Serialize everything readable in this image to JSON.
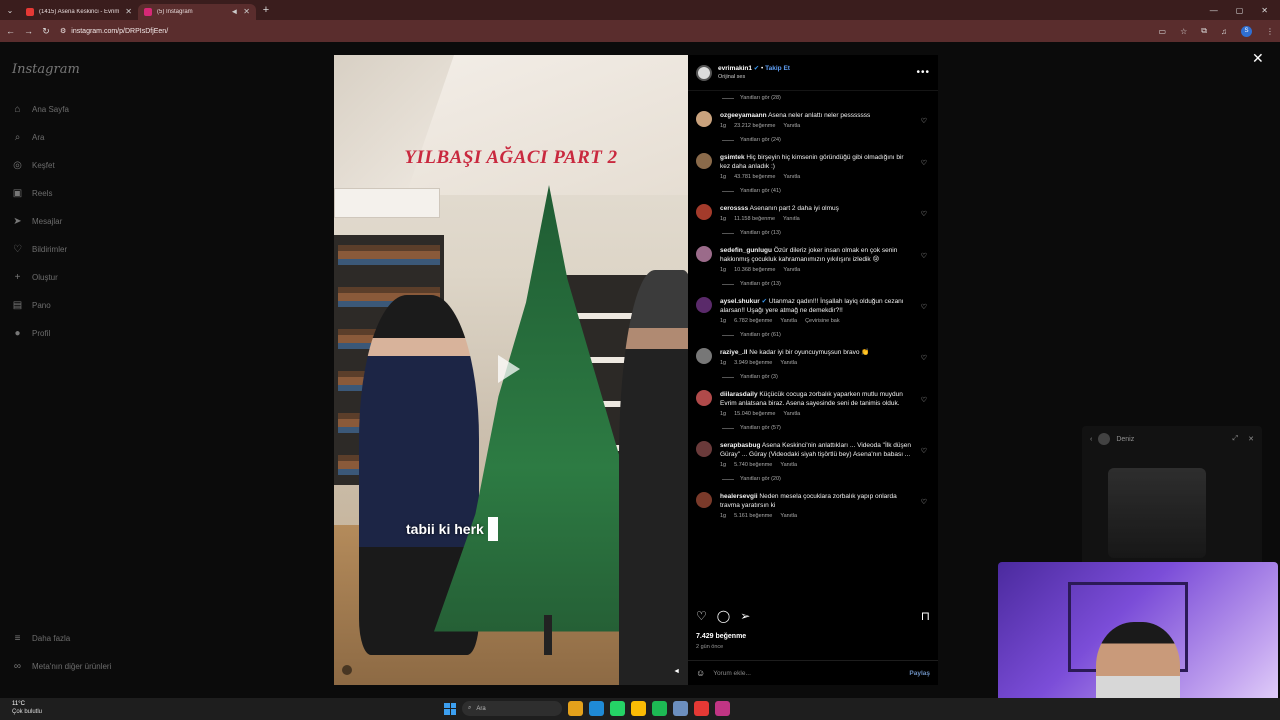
{
  "browser": {
    "tabs": [
      {
        "title": "(1415) Asena Keskinci - Evrim A",
        "fav_color": "#e53935",
        "active": false
      },
      {
        "title": "(5) Instagram",
        "fav_color": "#d62976",
        "active": true
      }
    ],
    "url": "instagram.com/p/DRPIsDfjEen/"
  },
  "sidebar": {
    "logo": "Instagram",
    "items": [
      {
        "label": "Ana Sayfa",
        "icon": "home-icon",
        "glyph": "⌂"
      },
      {
        "label": "Ara",
        "icon": "search-icon",
        "glyph": "⌕"
      },
      {
        "label": "Keşfet",
        "icon": "compass-icon",
        "glyph": "◎"
      },
      {
        "label": "Reels",
        "icon": "reels-icon",
        "glyph": "▣"
      },
      {
        "label": "Mesajlar",
        "icon": "messages-icon",
        "glyph": "➤"
      },
      {
        "label": "Bildirimler",
        "icon": "heart-icon",
        "glyph": "♡"
      },
      {
        "label": "Oluştur",
        "icon": "plus-icon",
        "glyph": "+"
      },
      {
        "label": "Pano",
        "icon": "dashboard-icon",
        "glyph": "▤"
      },
      {
        "label": "Profil",
        "icon": "profile-icon",
        "glyph": "●"
      }
    ],
    "more": "Daha fazla",
    "meta": "Meta'nın diğer ürünleri"
  },
  "post": {
    "video_title": "YILBAŞI AĞACI PART 2",
    "caption": "tabii ki herk",
    "author": "evrimakin1",
    "follow": "Takip Et",
    "audio": "Orijinal ses",
    "likes": "7.429 beğenme",
    "date": "2 gün önce",
    "add_comment_placeholder": "Yorum ekle...",
    "share": "Paylaş"
  },
  "comments": [
    {
      "replies": "Yanıtları gör (28)"
    },
    {
      "user": "ozgeeyamaann",
      "text": "Asena neler anlattı neler pesssssss",
      "time": "1g",
      "likes": "23.212 beğenme",
      "reply": "Yanıtla",
      "replies": "Yanıtları gör (24)",
      "avatar": "#c9a27d"
    },
    {
      "user": "gsimtek",
      "text": "Hiç birşeyin hiç kimsenin göründüğü gibi olmadığını bir kez daha anladık :)",
      "time": "1g",
      "likes": "43.781 beğenme",
      "reply": "Yanıtla",
      "replies": "Yanıtları gör (41)",
      "avatar": "#8a6a4a"
    },
    {
      "user": "cerossss",
      "text": "Asenanın part 2 daha iyi olmuş",
      "time": "1g",
      "likes": "11.158 beğenme",
      "reply": "Yanıtla",
      "replies": "Yanıtları gör (13)",
      "avatar": "#a33b2b"
    },
    {
      "user": "sedefin_gunlugu",
      "text": "Özür dileriz joker insan olmak en çok senin hakkınmış çocukluk kahramanımızın yıkılışını izledik 😢",
      "time": "1g",
      "likes": "10.368 beğenme",
      "reply": "Yanıtla",
      "replies": "Yanıtları gör (13)",
      "avatar": "#9b6b8a"
    },
    {
      "user": "aysel.shukur",
      "text": "Utanmaz qadın!!! İnşallah layiq olduğun cezanı alarsan!! Uşağı yere atmağ ne demekdir?!!",
      "time": "1g",
      "likes": "6.782 beğenme",
      "reply": "Yanıtla",
      "extra": "Çevirisine bak",
      "replies": "Yanıtları gör (61)",
      "avatar": "#5a2a6a"
    },
    {
      "user": "raziye_.ll",
      "text": "Ne kadar iyi bir oyuncuymuşsun bravo 👏",
      "time": "1g",
      "likes": "3.949 beğenme",
      "reply": "Yanıtla",
      "replies": "Yanıtları gör (3)",
      "avatar": "#777777"
    },
    {
      "user": "diilarasdaily",
      "text": "Küçücük cocuga zorbalık yaparken mutlu muydun Evrim anlatsana biraz. Asena sayesinde seni de tanimis olduk.",
      "time": "1g",
      "likes": "15.040 beğenme",
      "reply": "Yanıtla",
      "replies": "Yanıtları gör (57)",
      "avatar": "#b04a4a"
    },
    {
      "user": "serapbasbug",
      "text": "Asena Keskinci'nin anlattıkları ... Videoda \"İlk düşen Güray\" ... Güray (Videodaki siyah tişörtlü bey) Asena'nın babası ...",
      "time": "1g",
      "likes": "5.740 beğenme",
      "reply": "Yanıtla",
      "replies": "Yanıtları gör (20)",
      "avatar": "#6a3a3a"
    },
    {
      "user": "healersevgii",
      "text": "Neden mesela çocuklara zorbalık yapıp onlarda travma yaratırsın ki",
      "time": "1g",
      "likes": "5.161 beğenme",
      "reply": "Yanıtla",
      "avatar": "#7a3a2a"
    }
  ],
  "chat": {
    "name": "Deniz"
  },
  "taskbar": {
    "temp": "11°C",
    "weather": "Çok bulutlu",
    "search": "Ara",
    "apps": [
      "#3c9ff0",
      "#ffffff",
      "#e4a11b",
      "#0f9d58",
      "#25d366",
      "#fbbc05",
      "#1db954",
      "#6c8fbf",
      "#f0f0f0",
      "#e53935",
      "#c13584"
    ]
  }
}
